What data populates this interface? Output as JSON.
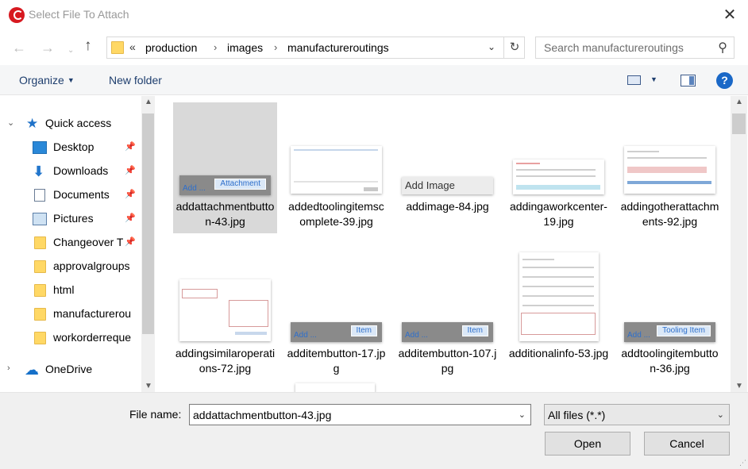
{
  "window": {
    "title": "Select File To Attach",
    "close_glyph": "✕"
  },
  "nav": {
    "back_glyph": "←",
    "forward_glyph": "→",
    "recent_glyph": "⌄",
    "up_glyph": "↑",
    "overflow_glyph": "«",
    "breadcrumb": [
      "production",
      "images",
      "manufactureroutings"
    ],
    "separator_glyph": "›",
    "dropdown_glyph": "⌄",
    "refresh_glyph": "↻",
    "search_placeholder": "Search manufactureroutings",
    "search_glyph": "⚲"
  },
  "toolbar": {
    "organize_label": "Organize",
    "caret_glyph": "▼",
    "new_folder_label": "New folder",
    "help_glyph": "?"
  },
  "sidebar": {
    "quick_access_label": "Quick access",
    "expand_glyph": "⌄",
    "collapsed_glyph": "›",
    "pin_glyph": "📌",
    "items": [
      {
        "label": "Desktop",
        "icon": "desktop-icon",
        "pinned": true
      },
      {
        "label": "Downloads",
        "icon": "download-icon",
        "pinned": true
      },
      {
        "label": "Documents",
        "icon": "documents-icon",
        "pinned": true
      },
      {
        "label": "Pictures",
        "icon": "pictures-icon",
        "pinned": true
      },
      {
        "label": "Changeover T",
        "icon": "folder-icon",
        "pinned": true
      },
      {
        "label": "approvalgroups",
        "icon": "folder-icon",
        "pinned": false
      },
      {
        "label": "html",
        "icon": "folder-icon",
        "pinned": false
      },
      {
        "label": "manufacturerou",
        "icon": "folder-icon",
        "pinned": false
      },
      {
        "label": "workorderreque",
        "icon": "folder-icon",
        "pinned": false
      }
    ],
    "onedrive_label": "OneDrive",
    "scroll_up_glyph": "▲",
    "scroll_down_glyph": "▼"
  },
  "files": [
    {
      "name": "addattachmentbutton-43.jpg",
      "selected": true,
      "thumb": {
        "kind": "button",
        "left_text": "Add ...",
        "button_text": "Attachment"
      }
    },
    {
      "name": "addedtoolingitemscomplete-39.jpg",
      "selected": false,
      "thumb": {
        "kind": "form"
      }
    },
    {
      "name": "addimage-84.jpg",
      "selected": false,
      "thumb": {
        "kind": "bar",
        "text": "Add Image"
      }
    },
    {
      "name": "addingaworkcenter-19.jpg",
      "selected": false,
      "thumb": {
        "kind": "form"
      }
    },
    {
      "name": "addingotherattachments-92.jpg",
      "selected": false,
      "thumb": {
        "kind": "form"
      }
    },
    {
      "name": "addingsimilaroperations-72.jpg",
      "selected": false,
      "thumb": {
        "kind": "form"
      }
    },
    {
      "name": "additembutton-17.jpg",
      "selected": false,
      "thumb": {
        "kind": "button",
        "left_text": "Add ...",
        "button_text": "Item"
      }
    },
    {
      "name": "additembutton-107.jpg",
      "selected": false,
      "thumb": {
        "kind": "button",
        "left_text": "Add ...",
        "button_text": "Item"
      }
    },
    {
      "name": "additionalinfo-53.jpg",
      "selected": false,
      "thumb": {
        "kind": "form"
      }
    },
    {
      "name": "addtoolingitembutton-36.jpg",
      "selected": false,
      "thumb": {
        "kind": "button",
        "left_text": "Add ...",
        "button_text": "Tooling Item"
      }
    }
  ],
  "footer": {
    "file_name_label": "File name:",
    "file_name_value": "addattachmentbutton-43.jpg",
    "file_type_value": "All files (*.*)",
    "dropdown_glyph": "⌄",
    "open_label": "Open",
    "cancel_label": "Cancel",
    "grip_glyph": "⋰"
  },
  "colors": {
    "accent": "#1a68c7",
    "selection": "#d9d9d9",
    "brand": "#d71920"
  }
}
